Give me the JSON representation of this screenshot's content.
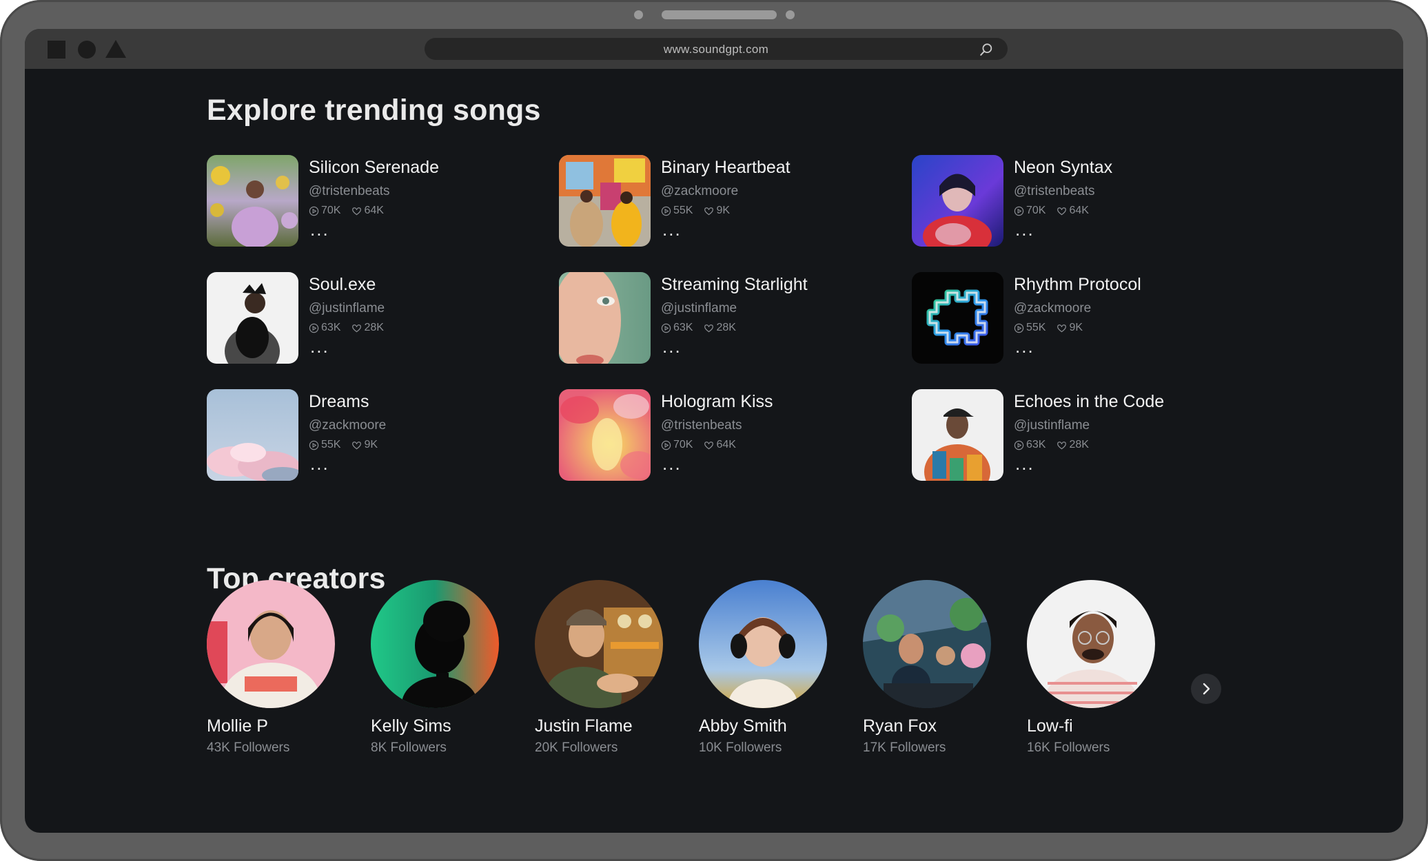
{
  "browser": {
    "url": "www.soundgpt.com",
    "search_icon": "search-icon"
  },
  "trending": {
    "title": "Explore trending songs",
    "songs": [
      {
        "title": "Silicon Serenade",
        "artist": "@tristenbeats",
        "plays": "70K",
        "likes": "64K",
        "more": "..."
      },
      {
        "title": "Binary Heartbeat",
        "artist": "@zackmoore",
        "plays": "55K",
        "likes": "9K",
        "more": "..."
      },
      {
        "title": "Neon Syntax",
        "artist": "@tristenbeats",
        "plays": "70K",
        "likes": "64K",
        "more": "..."
      },
      {
        "title": "Soul.exe",
        "artist": "@justinflame",
        "plays": "63K",
        "likes": "28K",
        "more": "..."
      },
      {
        "title": "Streaming Starlight",
        "artist": "@justinflame",
        "plays": "63K",
        "likes": "28K",
        "more": "..."
      },
      {
        "title": "Rhythm Protocol",
        "artist": "@zackmoore",
        "plays": "55K",
        "likes": "9K",
        "more": "..."
      },
      {
        "title": "Dreams",
        "artist": "@zackmoore",
        "plays": "55K",
        "likes": "9K",
        "more": "..."
      },
      {
        "title": "Hologram Kiss",
        "artist": "@tristenbeats",
        "plays": "70K",
        "likes": "64K",
        "more": "..."
      },
      {
        "title": "Echoes in the Code",
        "artist": "@justinflame",
        "plays": "63K",
        "likes": "28K",
        "more": "..."
      }
    ]
  },
  "creators": {
    "title": "Top creators",
    "items": [
      {
        "name": "Mollie P",
        "followers": "43K Followers"
      },
      {
        "name": "Kelly Sims",
        "followers": "8K Followers"
      },
      {
        "name": "Justin Flame",
        "followers": "20K Followers"
      },
      {
        "name": "Abby Smith",
        "followers": "10K Followers"
      },
      {
        "name": "Ryan Fox",
        "followers": "17K Followers"
      },
      {
        "name": "Low-fi",
        "followers": "16K Followers"
      }
    ],
    "next_icon": "chevron-right-icon"
  },
  "colors": {
    "background": "#141619",
    "frame": "#5e5e5e",
    "toolbar": "#3a3a3a",
    "text_primary": "#f2f2f2",
    "text_secondary": "#8a8d92"
  }
}
